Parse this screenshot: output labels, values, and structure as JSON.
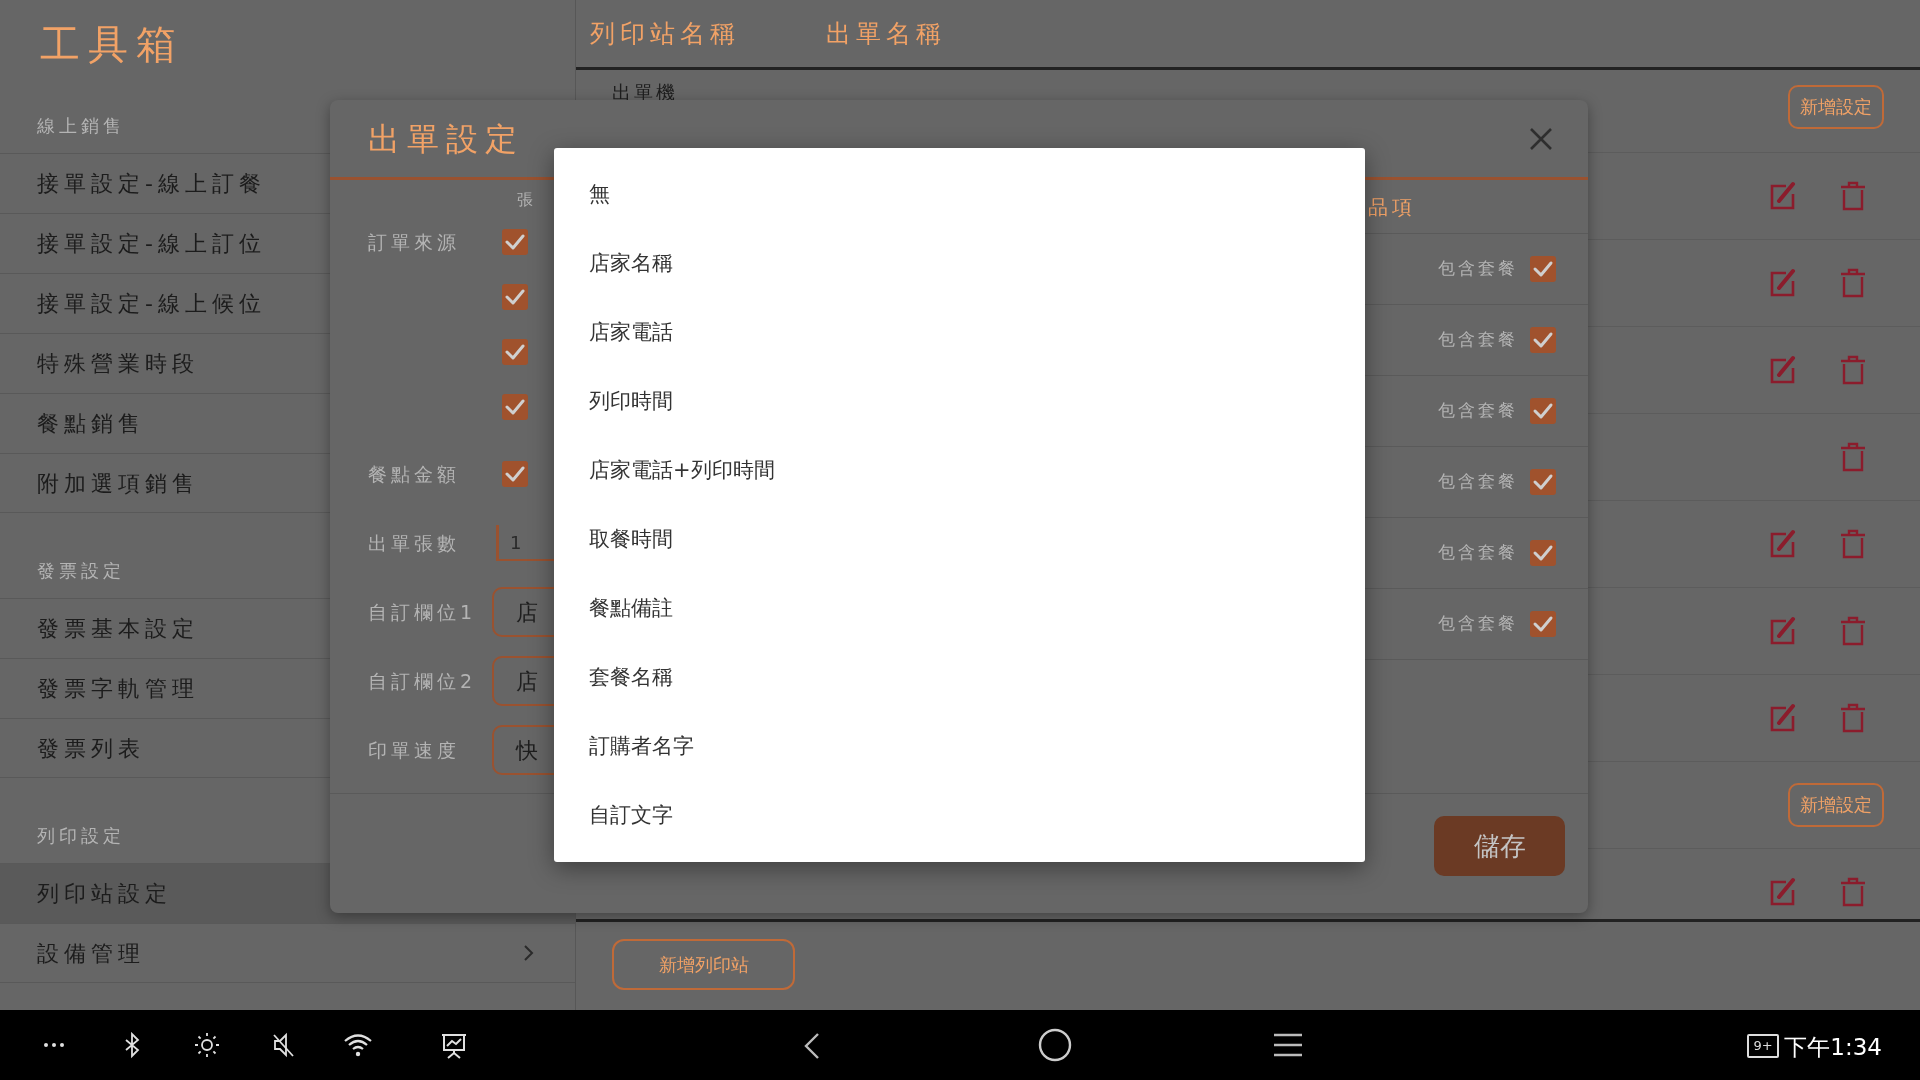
{
  "sidebar": {
    "title": "工具箱",
    "sections": [
      {
        "header": "線上銷售",
        "items": [
          {
            "label": "接單設定-線上訂餐",
            "selected": false
          },
          {
            "label": "接單設定-線上訂位",
            "selected": false
          },
          {
            "label": "接單設定-線上候位",
            "selected": false
          },
          {
            "label": "特殊營業時段",
            "selected": false
          },
          {
            "label": "餐點銷售",
            "selected": false
          },
          {
            "label": "附加選項銷售",
            "selected": false
          }
        ]
      },
      {
        "header": "發票設定",
        "items": [
          {
            "label": "發票基本設定",
            "selected": false
          },
          {
            "label": "發票字軌管理",
            "selected": false
          },
          {
            "label": "發票列表",
            "selected": false
          }
        ]
      },
      {
        "header": "列印設定",
        "items": [
          {
            "label": "列印站設定",
            "selected": true,
            "submenu": false
          },
          {
            "label": "設備管理",
            "selected": false,
            "submenu": true
          }
        ]
      }
    ]
  },
  "main": {
    "columns": [
      "列印站名稱",
      "出單名稱"
    ],
    "stations": [
      {
        "name": "出單機",
        "add_button": "新增設定",
        "rows": [
          {
            "editable": true
          },
          {
            "editable": true
          },
          {
            "editable": true
          },
          {
            "editable": false
          },
          {
            "editable": true
          },
          {
            "editable": true
          },
          {
            "editable": true
          }
        ]
      },
      {
        "add_button": "新增設定",
        "rows": [
          {
            "editable": true
          }
        ]
      }
    ],
    "add_station_button": "新增列印站"
  },
  "dialog": {
    "title": "出單設定",
    "column_hint": "張",
    "fields": [
      {
        "label": "訂單來源",
        "kind": "checkboxes",
        "options": [
          {
            "checked": true
          },
          {
            "checked": true
          },
          {
            "checked": true
          },
          {
            "checked": true
          }
        ]
      },
      {
        "label": "餐點金額",
        "kind": "checkboxes",
        "options": [
          {
            "checked": true
          }
        ]
      },
      {
        "label": "出單張數",
        "kind": "input",
        "value": "1"
      },
      {
        "label": "自訂欄位1",
        "kind": "select",
        "value": "店"
      },
      {
        "label": "自訂欄位2",
        "kind": "select",
        "value": "店"
      },
      {
        "label": "印單速度",
        "kind": "select",
        "value": "快"
      }
    ],
    "items_header": "品項",
    "items": [
      {
        "label": "包含套餐",
        "checked": true
      },
      {
        "label": "包含套餐",
        "checked": true
      },
      {
        "label": "包含套餐",
        "checked": true
      },
      {
        "label": "包含套餐",
        "checked": true
      },
      {
        "label": "包含套餐",
        "checked": true
      },
      {
        "label": "包含套餐",
        "checked": true
      }
    ],
    "save_button": "儲存"
  },
  "dropdown": {
    "options": [
      "無",
      "店家名稱",
      "店家電話",
      "列印時間",
      "店家電話+列印時間",
      "取餐時間",
      "餐點備註",
      "套餐名稱",
      "訂購者名字",
      "自訂文字"
    ]
  },
  "status_bar": {
    "notification_count": "9+",
    "time": "下午1:34"
  }
}
